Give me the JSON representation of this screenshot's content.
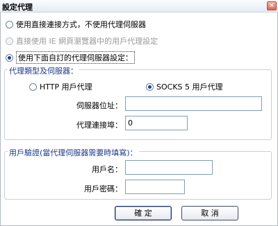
{
  "window": {
    "title": "設定代理",
    "close_glyph": "✕"
  },
  "options": {
    "direct": "使用直接連接方式，不使用代理伺服器",
    "ie_settings": "直接使用 IE 網頁瀏覽器中的用戶代理設定",
    "custom": "使用下面自訂的代理伺服器設定："
  },
  "proxy_group": {
    "legend": "代理類型及伺服器：",
    "http_label": "HTTP 用戶代理",
    "socks5_label": "SOCKS 5 用戶代理",
    "server_label": "伺服器位址：",
    "server_value": "",
    "port_label": "代理連接埠：",
    "port_value": "0"
  },
  "auth_group": {
    "legend": "用戶驗證(當代理伺服器需要時填寫)：",
    "username_label": "用戶名：",
    "username_value": "",
    "password_label": "用戶密碼：",
    "password_value": ""
  },
  "buttons": {
    "ok": "確 定",
    "cancel": "取 消"
  }
}
